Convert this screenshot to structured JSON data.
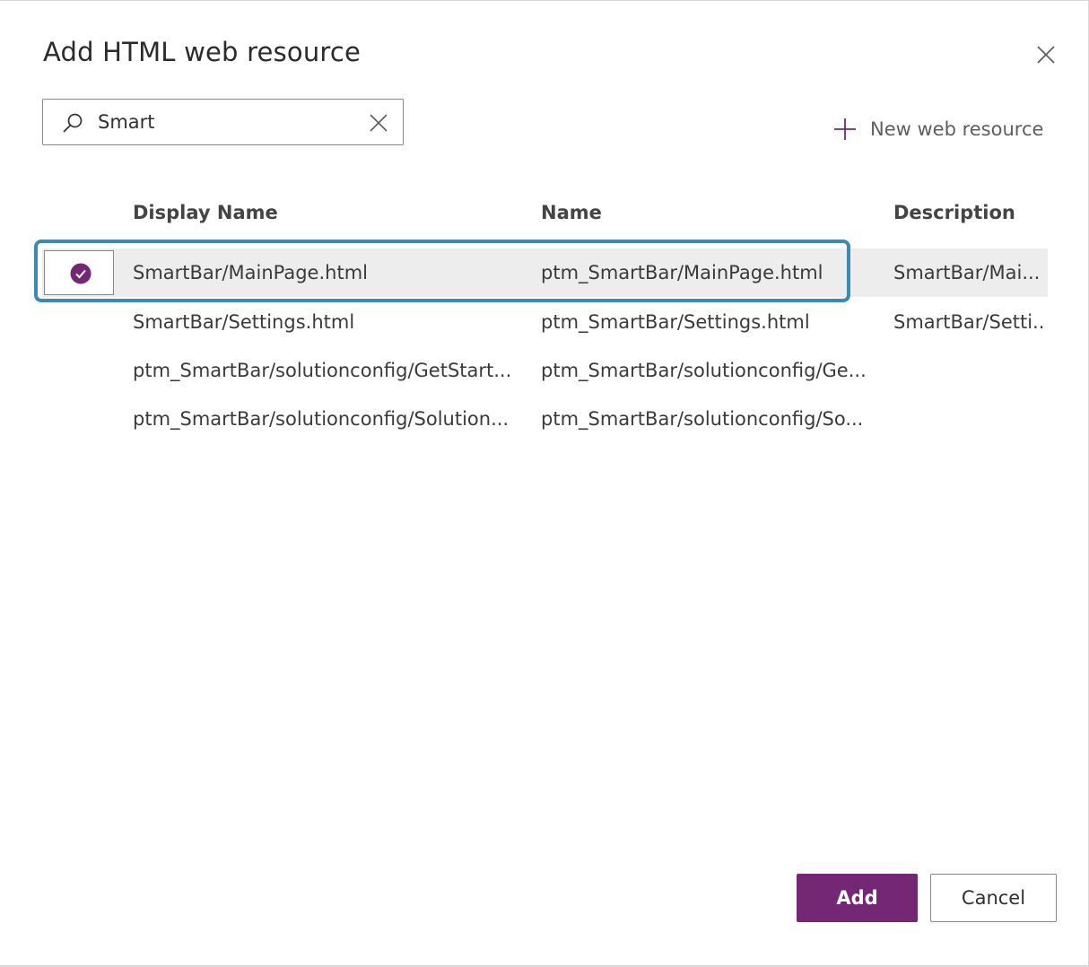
{
  "dialog": {
    "title": "Add HTML web resource",
    "close_icon": "close-icon"
  },
  "search": {
    "value": "Smart",
    "icon": "search-icon",
    "clear_icon": "clear-icon"
  },
  "toolbar": {
    "new_resource_label": "New web resource",
    "new_resource_icon": "plus-icon"
  },
  "grid": {
    "columns": [
      "Display Name",
      "Name",
      "Description"
    ],
    "rows": [
      {
        "display_name": "SmartBar/MainPage.html",
        "name": "ptm_SmartBar/MainPage.html",
        "description": "SmartBar/Mai...",
        "selected": true
      },
      {
        "display_name": "SmartBar/Settings.html",
        "name": "ptm_SmartBar/Settings.html",
        "description": "SmartBar/Setti...",
        "selected": false
      },
      {
        "display_name": "ptm_SmartBar/solutionconfig/GetStart...",
        "name": "ptm_SmartBar/solutionconfig/Ge...",
        "description": "",
        "selected": false
      },
      {
        "display_name": "ptm_SmartBar/solutionconfig/Solution...",
        "name": "ptm_SmartBar/solutionconfig/So...",
        "description": "",
        "selected": false
      }
    ]
  },
  "footer": {
    "add_label": "Add",
    "cancel_label": "Cancel"
  },
  "colors": {
    "accent": "#742774",
    "focus": "#3a8ab5",
    "selected_row": "#ededed"
  }
}
